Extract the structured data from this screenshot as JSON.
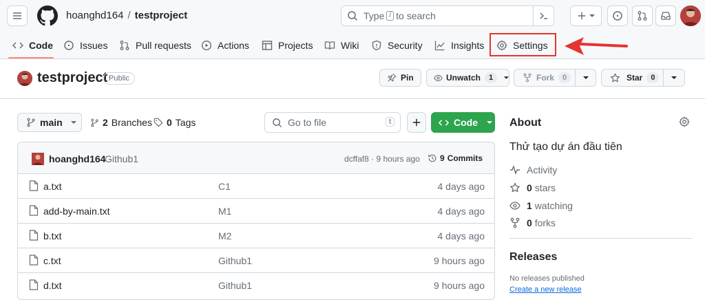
{
  "header": {
    "owner": "hoanghd164",
    "separator": "/",
    "repo": "testproject",
    "search": {
      "prefix": "Type",
      "key": "/",
      "suffix": "to search"
    }
  },
  "nav": {
    "items": [
      {
        "label": "Code",
        "icon": "code-icon",
        "active": true
      },
      {
        "label": "Issues",
        "icon": "issue-opened-icon"
      },
      {
        "label": "Pull requests",
        "icon": "git-pull-request-icon"
      },
      {
        "label": "Actions",
        "icon": "play-icon"
      },
      {
        "label": "Projects",
        "icon": "table-icon"
      },
      {
        "label": "Wiki",
        "icon": "book-icon"
      },
      {
        "label": "Security",
        "icon": "shield-icon"
      },
      {
        "label": "Insights",
        "icon": "graph-icon"
      },
      {
        "label": "Settings",
        "icon": "gear-icon"
      }
    ],
    "highlight_color": "#e3342f"
  },
  "repo": {
    "title": "testproject",
    "visibility": "Public",
    "actions": {
      "pin": "Pin",
      "unwatch": "Unwatch",
      "watch_count": "1",
      "fork": "Fork",
      "fork_count": "0",
      "star": "Star",
      "star_count": "0"
    }
  },
  "toolbar": {
    "branch": "main",
    "branches_count": "2",
    "branches_label": "Branches",
    "tags_count": "0",
    "tags_label": "Tags",
    "goto_placeholder": "Go to file",
    "goto_key": "t",
    "code_label": "Code",
    "code_color": "#2da44e"
  },
  "latest_commit": {
    "author": "hoanghd164",
    "message": "Github1",
    "sha_time": "dcffaf8 · 9 hours ago",
    "commits_count": "9",
    "commits_label": "Commits"
  },
  "files": [
    {
      "name": "a.txt",
      "commit": "C1",
      "time": "4 days ago"
    },
    {
      "name": "add-by-main.txt",
      "commit": "M1",
      "time": "4 days ago"
    },
    {
      "name": "b.txt",
      "commit": "M2",
      "time": "4 days ago"
    },
    {
      "name": "c.txt",
      "commit": "Github1",
      "time": "9 hours ago"
    },
    {
      "name": "d.txt",
      "commit": "Github1",
      "time": "9 hours ago"
    }
  ],
  "about": {
    "title": "About",
    "description": "Thử tạo dự án đầu tiên",
    "activity": "Activity",
    "stars_count": "0",
    "stars_label": "stars",
    "watching_count": "1",
    "watching_label": "watching",
    "forks_count": "0",
    "forks_label": "forks"
  },
  "releases": {
    "title": "Releases",
    "none": "No releases published",
    "create": "Create a new release"
  }
}
